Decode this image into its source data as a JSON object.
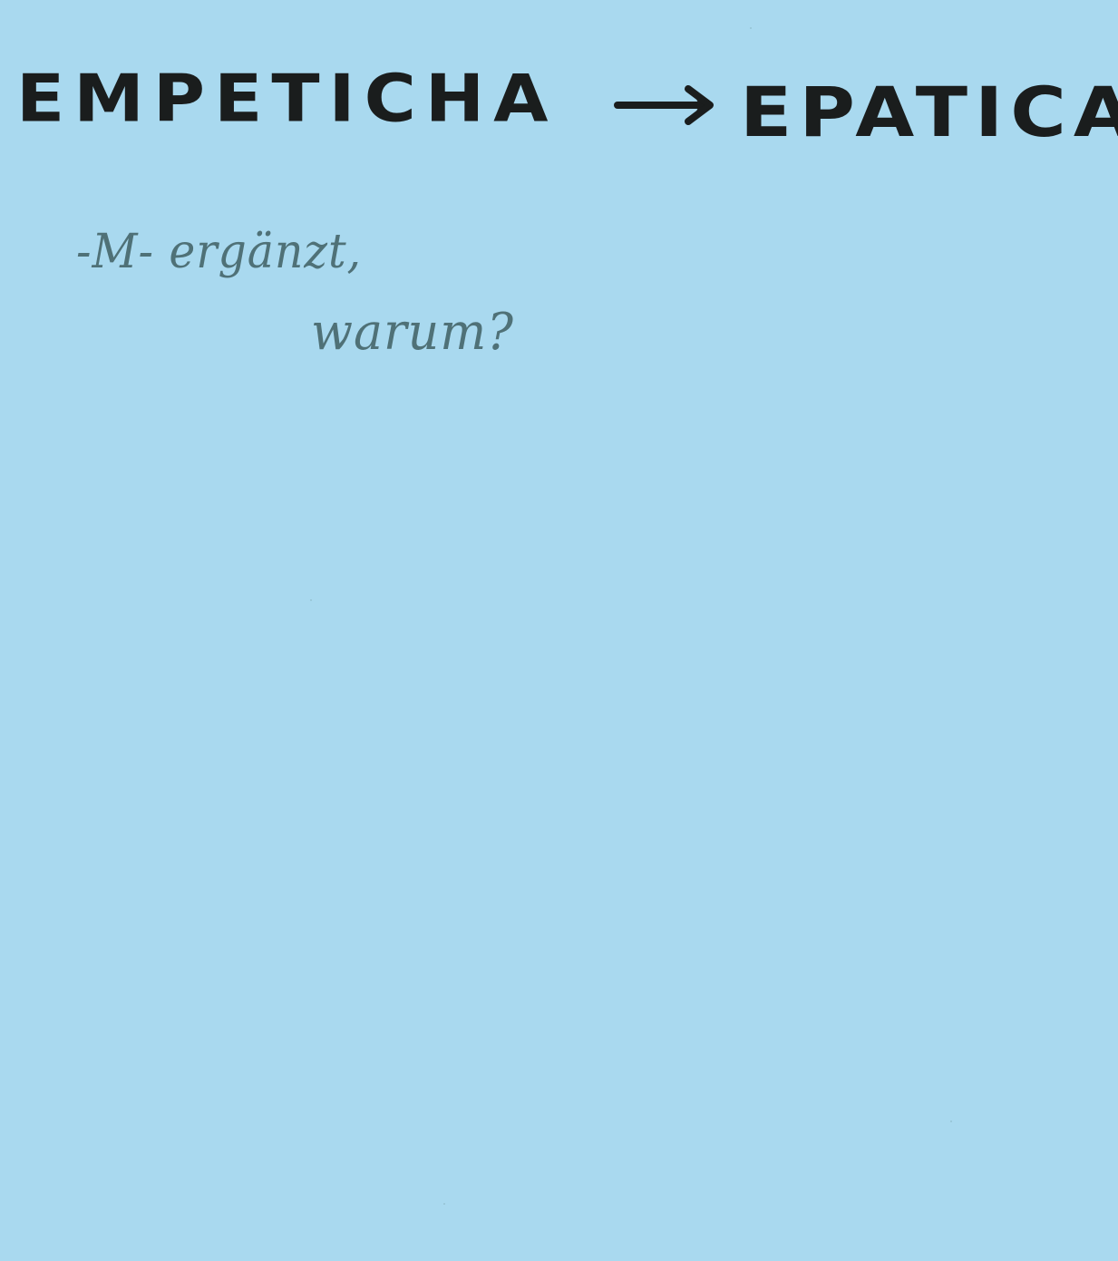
{
  "headline": {
    "source": "EMPETICHA",
    "target": "EPATICA"
  },
  "note": {
    "line1": "-M- ergänzt,",
    "line2": "warum?"
  },
  "colors": {
    "paper": "#a9d9ef",
    "marker": "#1a1d1d",
    "pencil": "#4f7177"
  },
  "icons": {
    "arrow": "right-arrow-icon"
  }
}
